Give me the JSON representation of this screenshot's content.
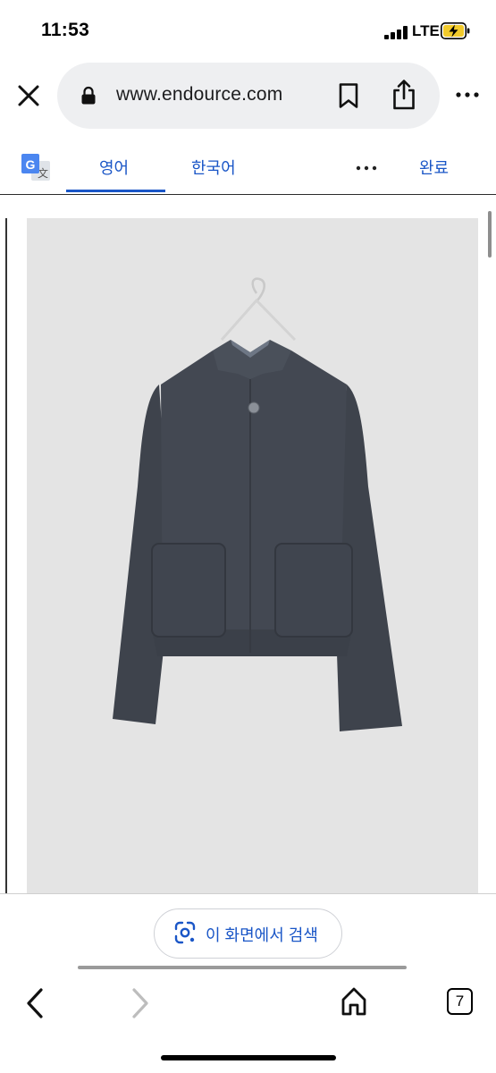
{
  "status": {
    "time": "11:53",
    "network": "LTE"
  },
  "browser": {
    "url": "www.endource.com",
    "icons": [
      "close-icon",
      "lock-icon",
      "bookmark-icon",
      "share-icon",
      "more-icon"
    ]
  },
  "translate": {
    "tabs": [
      {
        "label": "영어",
        "selected": true
      },
      {
        "label": "한국어",
        "selected": false
      }
    ],
    "done_label": "완료"
  },
  "lens": {
    "label": "이 화면에서 검색"
  },
  "toolbar": {
    "tab_count": "7"
  },
  "colors": {
    "accent": "#1a56c7",
    "photo_bg": "#e4e4e4",
    "jacket": "#3e434c"
  }
}
